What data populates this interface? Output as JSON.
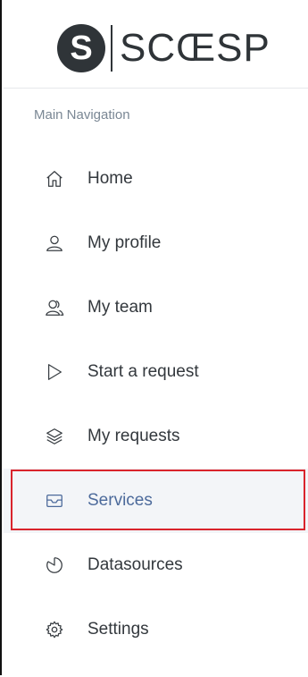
{
  "logo": {
    "mark": "S",
    "text": "SCŒSP"
  },
  "sidebar": {
    "section_label": "Main Navigation",
    "items": [
      {
        "label": "Home",
        "icon": "home-icon"
      },
      {
        "label": "My profile",
        "icon": "user-icon"
      },
      {
        "label": "My team",
        "icon": "team-icon"
      },
      {
        "label": "Start a request",
        "icon": "play-icon"
      },
      {
        "label": "My requests",
        "icon": "layers-icon"
      },
      {
        "label": "Services",
        "icon": "inbox-icon",
        "active": true
      },
      {
        "label": "Datasources",
        "icon": "pie-chart-icon"
      },
      {
        "label": "Settings",
        "icon": "gear-icon"
      }
    ]
  },
  "colors": {
    "active_text": "#4c6a9b",
    "highlight_border": "#d9242c",
    "text": "#33383d",
    "section_label": "#7a8794"
  }
}
